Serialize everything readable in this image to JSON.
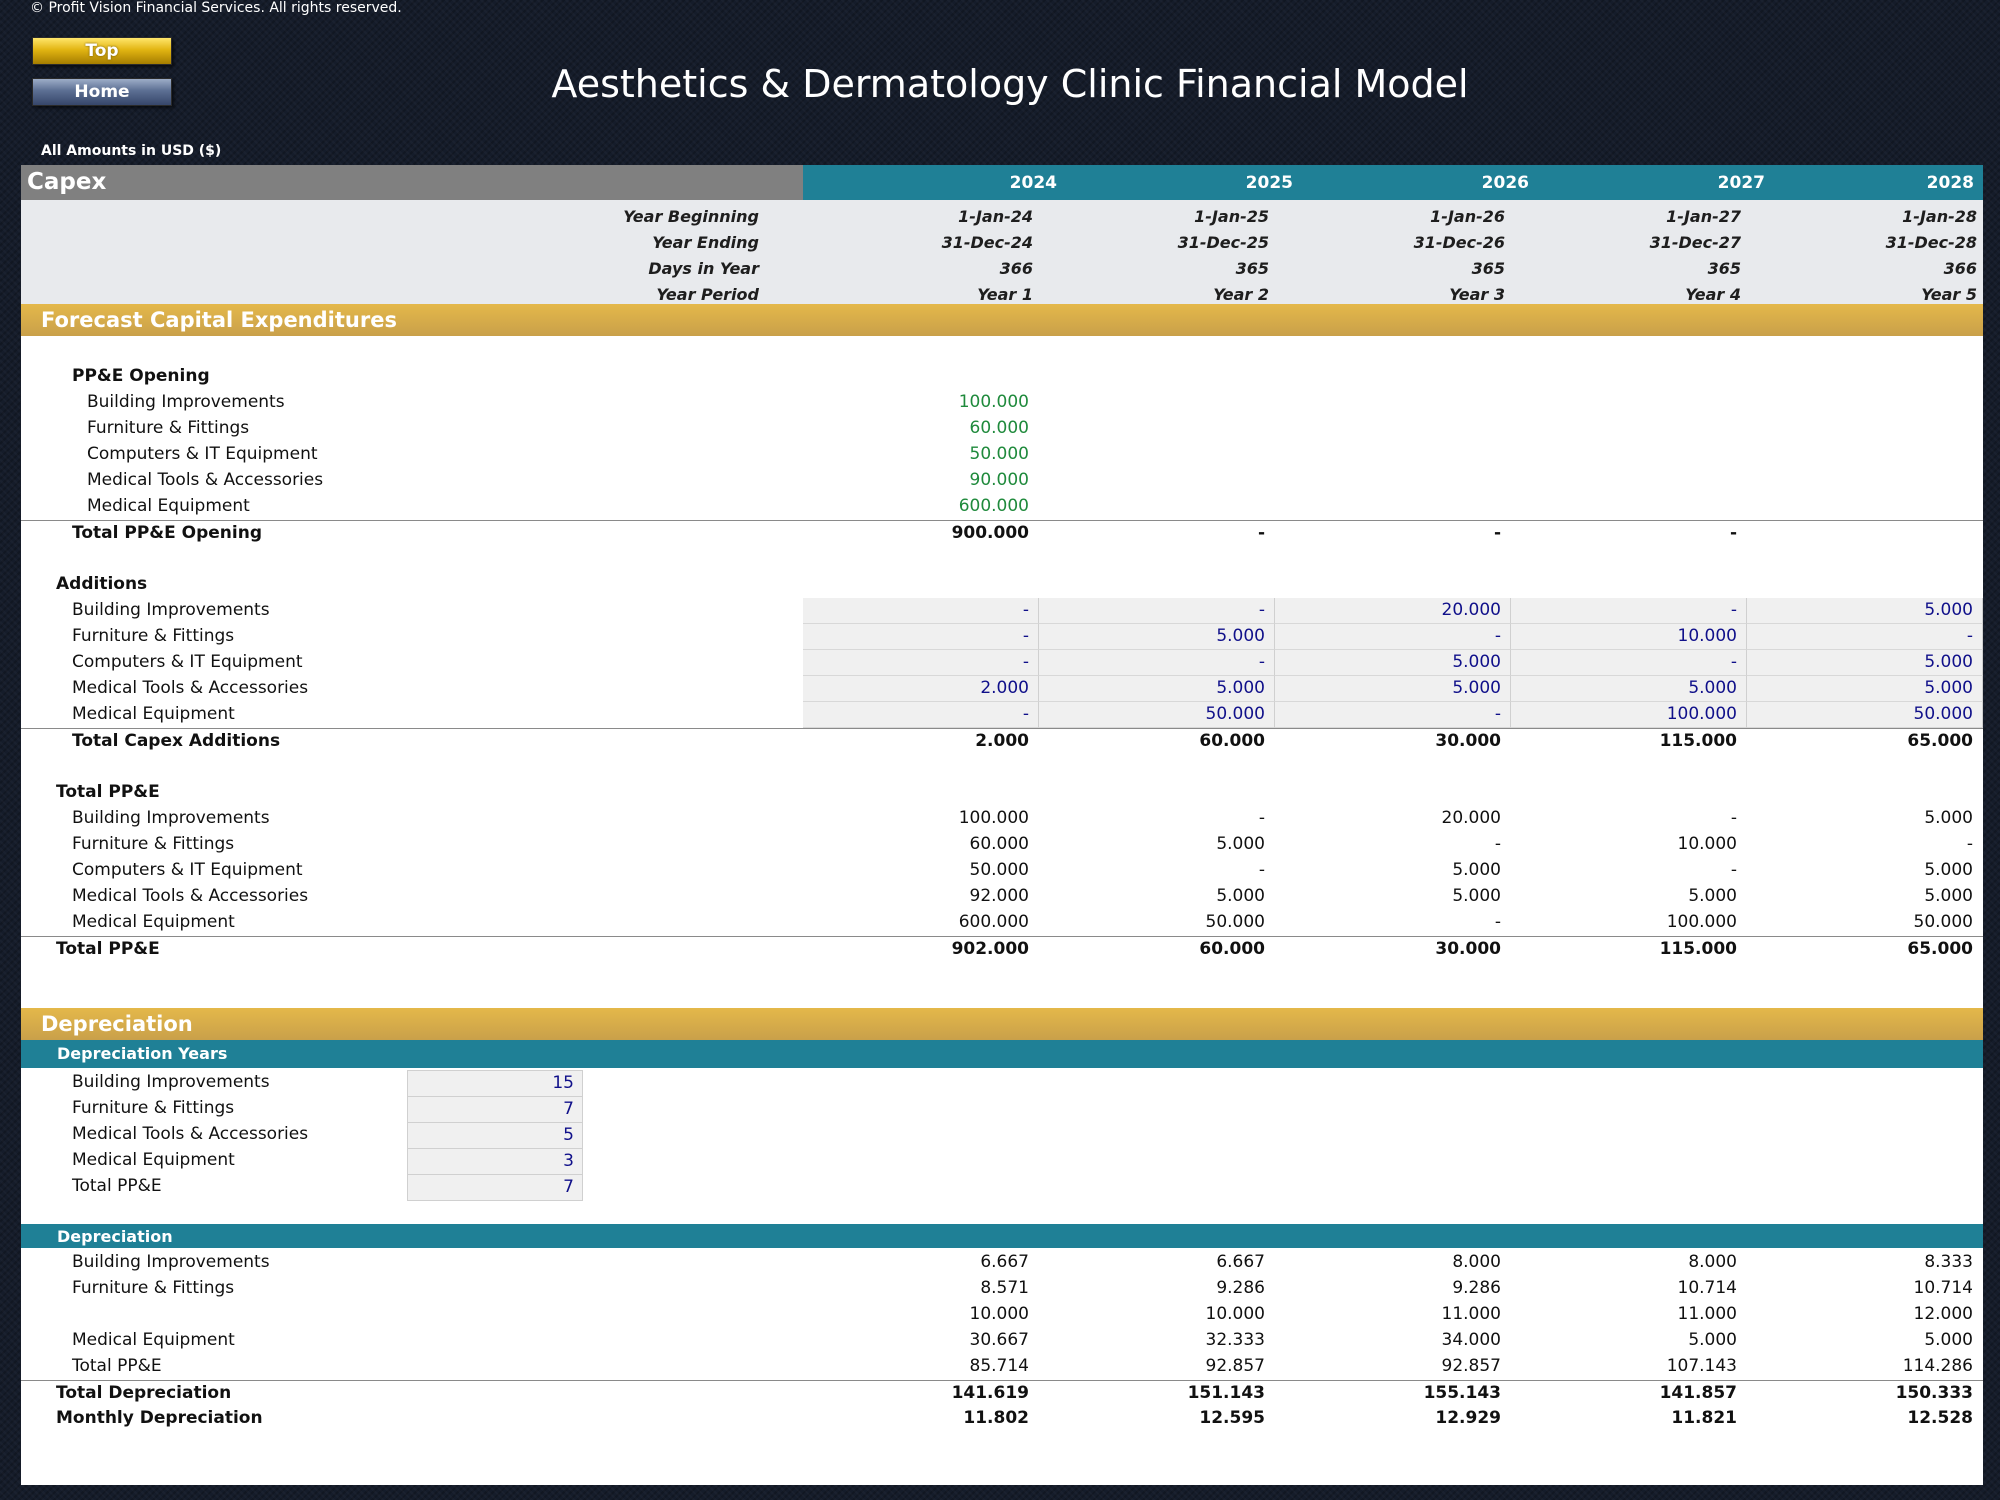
{
  "copyright": "© Profit Vision Financial Services. All rights reserved.",
  "nav": {
    "top_label": "Top",
    "home_label": "Home"
  },
  "title": "Aesthetics & Dermatology Clinic Financial Model",
  "amounts_note": "All Amounts in  USD ($)",
  "sheet_name": "Capex",
  "years": [
    "2024",
    "2025",
    "2026",
    "2027",
    "2028"
  ],
  "timeline": {
    "labels": {
      "begin": "Year Beginning",
      "end": "Year Ending",
      "days": "Days in Year",
      "period": "Year Period"
    },
    "begin": [
      "1-Jan-24",
      "1-Jan-25",
      "1-Jan-26",
      "1-Jan-27",
      "1-Jan-28"
    ],
    "end": [
      "31-Dec-24",
      "31-Dec-25",
      "31-Dec-26",
      "31-Dec-27",
      "31-Dec-28"
    ],
    "days": [
      "366",
      "365",
      "365",
      "365",
      "366"
    ],
    "period": [
      "Year 1",
      "Year 2",
      "Year 3",
      "Year 4",
      "Year 5"
    ]
  },
  "forecast": {
    "title": "Forecast Capital Expenditures",
    "opening": {
      "heading": "PP&E Opening",
      "rows": [
        {
          "label": "Building Improvements",
          "value": "100.000"
        },
        {
          "label": "Furniture & Fittings",
          "value": "60.000"
        },
        {
          "label": "Computers & IT Equipment",
          "value": "50.000"
        },
        {
          "label": "Medical Tools & Accessories",
          "value": "90.000"
        },
        {
          "label": "Medical Equipment",
          "value": "600.000"
        }
      ],
      "total": {
        "label": "Total PP&E Opening",
        "values": [
          "900.000",
          "-",
          "-",
          "-",
          ""
        ]
      }
    },
    "additions": {
      "heading": "Additions",
      "rows": [
        {
          "label": "Building Improvements",
          "values": [
            "-",
            "-",
            "20.000",
            "-",
            "5.000"
          ]
        },
        {
          "label": "Furniture & Fittings",
          "values": [
            "-",
            "5.000",
            "-",
            "10.000",
            "-"
          ]
        },
        {
          "label": "Computers & IT Equipment",
          "values": [
            "-",
            "-",
            "5.000",
            "-",
            "5.000"
          ]
        },
        {
          "label": "Medical Tools & Accessories",
          "values": [
            "2.000",
            "5.000",
            "5.000",
            "5.000",
            "5.000"
          ]
        },
        {
          "label": "Medical Equipment",
          "values": [
            "-",
            "50.000",
            "-",
            "100.000",
            "50.000"
          ]
        }
      ],
      "total": {
        "label": "Total Capex Additions",
        "values": [
          "2.000",
          "60.000",
          "30.000",
          "115.000",
          "65.000"
        ]
      }
    },
    "total_ppe": {
      "heading": "Total PP&E",
      "rows": [
        {
          "label": "Building Improvements",
          "values": [
            "100.000",
            "-",
            "20.000",
            "-",
            "5.000"
          ]
        },
        {
          "label": "Furniture & Fittings",
          "values": [
            "60.000",
            "5.000",
            "-",
            "10.000",
            "-"
          ]
        },
        {
          "label": "Computers & IT Equipment",
          "values": [
            "50.000",
            "-",
            "5.000",
            "-",
            "5.000"
          ]
        },
        {
          "label": "Medical Tools & Accessories",
          "values": [
            "92.000",
            "5.000",
            "5.000",
            "5.000",
            "5.000"
          ]
        },
        {
          "label": "Medical Equipment",
          "values": [
            "600.000",
            "50.000",
            "-",
            "100.000",
            "50.000"
          ]
        }
      ],
      "total": {
        "label": "Total PP&E",
        "values": [
          "902.000",
          "60.000",
          "30.000",
          "115.000",
          "65.000"
        ]
      }
    }
  },
  "depreciation": {
    "title": "Depreciation",
    "years_title": "Depreciation Years",
    "years_rows": [
      {
        "label": "Building Improvements",
        "value": "15"
      },
      {
        "label": "Furniture & Fittings",
        "value": "7"
      },
      {
        "label": "Medical Tools & Accessories",
        "value": "5"
      },
      {
        "label": "Medical Equipment",
        "value": "3"
      },
      {
        "label": "Total PP&E",
        "value": "7"
      }
    ],
    "dep_title": "Depreciation",
    "rows": [
      {
        "label": "Building Improvements",
        "values": [
          "6.667",
          "6.667",
          "8.000",
          "8.000",
          "8.333"
        ]
      },
      {
        "label": "Furniture & Fittings",
        "values": [
          "8.571",
          "9.286",
          "9.286",
          "10.714",
          "10.714"
        ]
      },
      {
        "label": "",
        "values": [
          "10.000",
          "10.000",
          "11.000",
          "11.000",
          "12.000"
        ]
      },
      {
        "label": "Medical Equipment",
        "values": [
          "30.667",
          "32.333",
          "34.000",
          "5.000",
          "5.000"
        ]
      },
      {
        "label": "Total PP&E",
        "values": [
          "85.714",
          "92.857",
          "92.857",
          "107.143",
          "114.286"
        ]
      }
    ],
    "total": {
      "label": "Total Depreciation",
      "values": [
        "141.619",
        "151.143",
        "155.143",
        "141.857",
        "150.333"
      ]
    },
    "monthly": {
      "label": "Monthly Depreciation",
      "values": [
        "11.802",
        "12.595",
        "12.929",
        "11.821",
        "12.528"
      ]
    }
  },
  "colors": {
    "teal": "#1f8096",
    "gold": "#d4a94a",
    "input_blue": "#10108a",
    "opening_green": "#1f8a3c"
  }
}
